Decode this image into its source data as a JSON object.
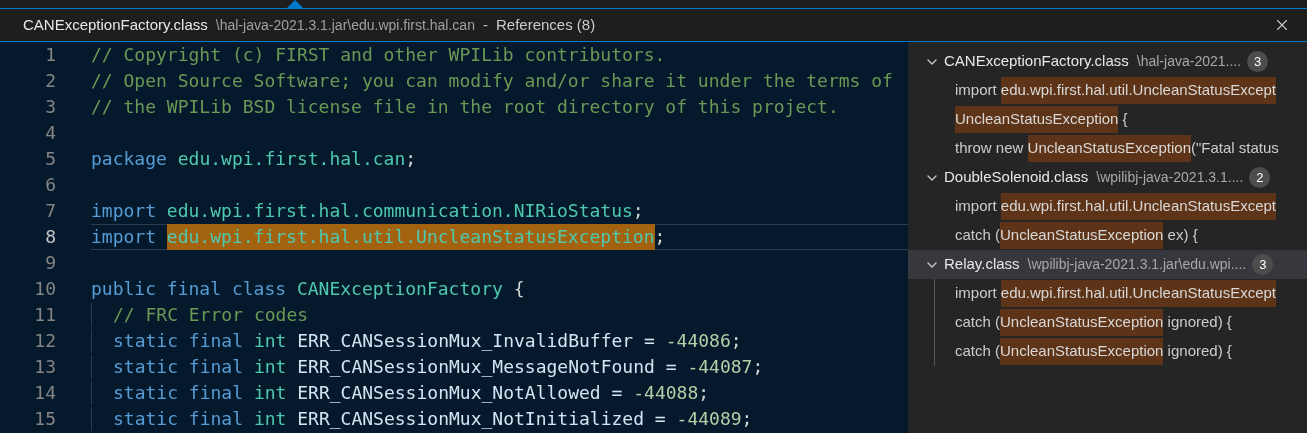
{
  "header": {
    "file": "CANExceptionFactory.class",
    "path": "\\hal-java-2021.3.1.jar\\edu.wpi.first.hal.can",
    "separator": "-",
    "title": "References (8)"
  },
  "editor": {
    "lines": [
      {
        "number": "1",
        "current": false,
        "indent": false,
        "tokens": [
          {
            "kind": "comment",
            "text": "// Copyright (c) FIRST and other WPILib contributors."
          }
        ]
      },
      {
        "number": "2",
        "current": false,
        "indent": false,
        "tokens": [
          {
            "kind": "comment",
            "text": "// Open Source Software; you can modify and/or share it under the terms of"
          }
        ]
      },
      {
        "number": "3",
        "current": false,
        "indent": false,
        "tokens": [
          {
            "kind": "comment",
            "text": "// the WPILib BSD license file in the root directory of this project."
          }
        ]
      },
      {
        "number": "4",
        "current": false,
        "indent": false
      },
      {
        "number": "5",
        "current": false,
        "indent": false,
        "tokens": [
          {
            "kind": "keyword",
            "text": "package "
          },
          {
            "kind": "type",
            "text": "edu.wpi.first.hal.can"
          },
          {
            "kind": "plain",
            "text": ";"
          }
        ]
      },
      {
        "number": "6",
        "current": false,
        "indent": false
      },
      {
        "number": "7",
        "current": false,
        "indent": false,
        "tokens": [
          {
            "kind": "keyword",
            "text": "import "
          },
          {
            "kind": "type",
            "text": "edu.wpi.first.hal.communication.NIRioStatus"
          },
          {
            "kind": "plain",
            "text": ";"
          }
        ]
      },
      {
        "number": "8",
        "current": true,
        "indent": false,
        "tokens": [
          {
            "kind": "keyword",
            "text": "import "
          },
          {
            "kind": "match",
            "text": "edu.wpi.first.hal.util.UncleanStatusException"
          },
          {
            "kind": "plain",
            "text": ";"
          }
        ]
      },
      {
        "number": "9",
        "current": false,
        "indent": false
      },
      {
        "number": "10",
        "current": false,
        "indent": false,
        "tokens": [
          {
            "kind": "keyword",
            "text": "public final class "
          },
          {
            "kind": "type",
            "text": "CANExceptionFactory"
          },
          {
            "kind": "plain",
            "text": " {"
          }
        ]
      },
      {
        "number": "11",
        "current": false,
        "indent": true,
        "tokens": [
          {
            "kind": "comment",
            "text": "// FRC Error codes"
          }
        ]
      },
      {
        "number": "12",
        "current": false,
        "indent": true,
        "tokens": [
          {
            "kind": "keyword",
            "text": "static final "
          },
          {
            "kind": "type",
            "text": "int "
          },
          {
            "kind": "variable",
            "text": "ERR_CANSessionMux_InvalidBuffer = "
          },
          {
            "kind": "number",
            "text": "-44086"
          },
          {
            "kind": "plain",
            "text": ";"
          }
        ]
      },
      {
        "number": "13",
        "current": false,
        "indent": true,
        "tokens": [
          {
            "kind": "keyword",
            "text": "static final "
          },
          {
            "kind": "type",
            "text": "int "
          },
          {
            "kind": "variable",
            "text": "ERR_CANSessionMux_MessageNotFound = "
          },
          {
            "kind": "number",
            "text": "-44087"
          },
          {
            "kind": "plain",
            "text": ";"
          }
        ]
      },
      {
        "number": "14",
        "current": false,
        "indent": true,
        "tokens": [
          {
            "kind": "keyword",
            "text": "static final "
          },
          {
            "kind": "type",
            "text": "int "
          },
          {
            "kind": "variable",
            "text": "ERR_CANSessionMux_NotAllowed = "
          },
          {
            "kind": "number",
            "text": "-44088"
          },
          {
            "kind": "plain",
            "text": ";"
          }
        ]
      },
      {
        "number": "15",
        "current": false,
        "indent": true,
        "tokens": [
          {
            "kind": "keyword",
            "text": "static final "
          },
          {
            "kind": "type",
            "text": "int "
          },
          {
            "kind": "variable",
            "text": "ERR_CANSessionMux_NotInitialized = "
          },
          {
            "kind": "number",
            "text": "-44089"
          },
          {
            "kind": "plain",
            "text": ";"
          }
        ]
      }
    ]
  },
  "references": [
    {
      "file": "CANExceptionFactory.class",
      "path": "\\hal-java-2021....",
      "count": "3",
      "expanded": true,
      "selected": false,
      "items": [
        {
          "before": "import ",
          "match": "edu.wpi.first.hal.util.UncleanStatusExcept"
        },
        {
          "match": "UncleanStatusException",
          "after": " {"
        },
        {
          "before": "throw new ",
          "match": "UncleanStatusException",
          "after": "(\"Fatal status"
        }
      ]
    },
    {
      "file": "DoubleSolenoid.class",
      "path": "\\wpilibj-java-2021.3.1....",
      "count": "2",
      "expanded": true,
      "selected": false,
      "items": [
        {
          "before": "import ",
          "match": "edu.wpi.first.hal.util.UncleanStatusExcept"
        },
        {
          "before": "catch (",
          "match": "UncleanStatusException",
          "after": " ex) {"
        }
      ]
    },
    {
      "file": "Relay.class",
      "path": "\\wpilibj-java-2021.3.1.jar\\edu.wpi....",
      "count": "3",
      "expanded": true,
      "selected": true,
      "items": [
        {
          "before": "import ",
          "match": "edu.wpi.first.hal.util.UncleanStatusExcept"
        },
        {
          "before": "catch (",
          "match": "UncleanStatusException",
          "after": " ignored) {"
        },
        {
          "before": "catch (",
          "match": "UncleanStatusException",
          "after": " ignored) {"
        }
      ]
    }
  ]
}
